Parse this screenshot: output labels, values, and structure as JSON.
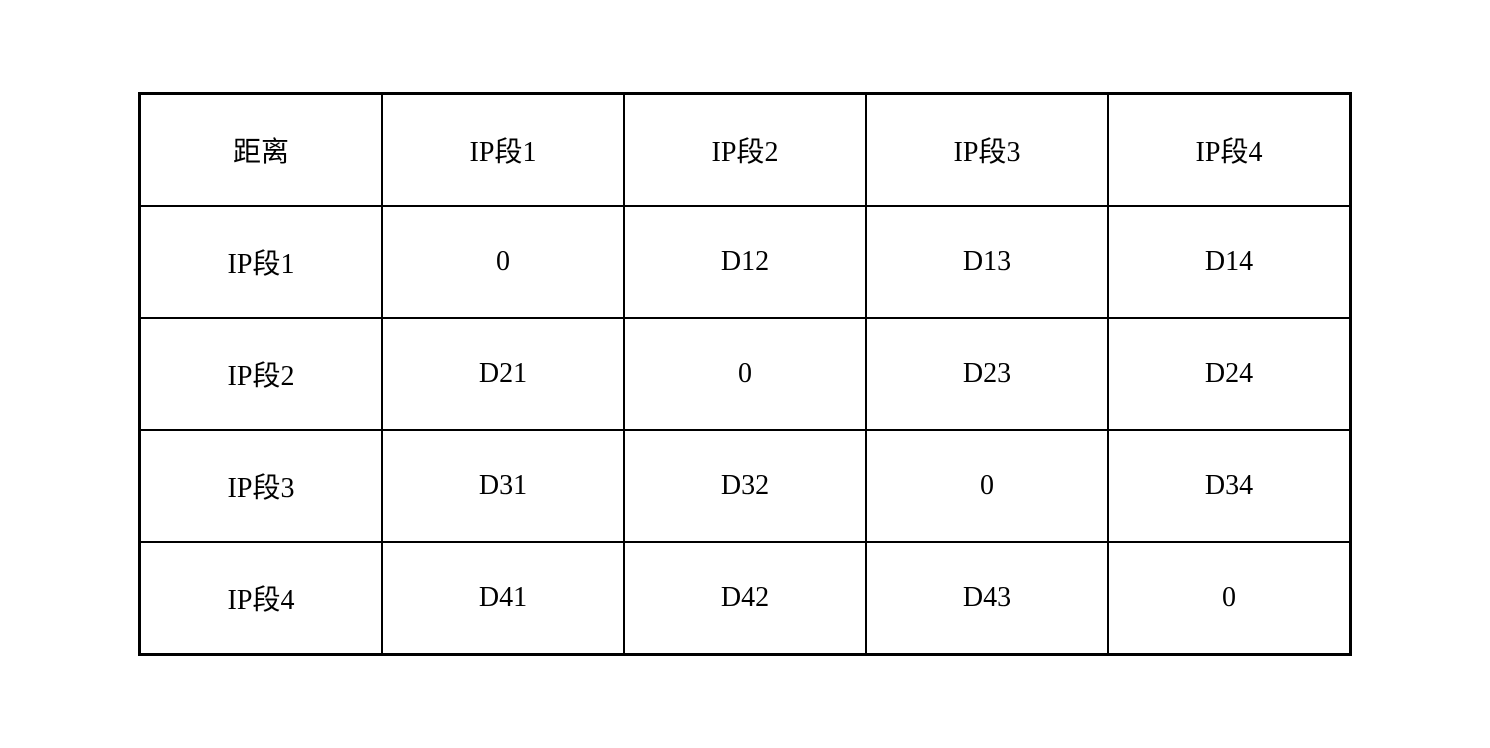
{
  "table": {
    "header": [
      "距离",
      "IP段1",
      "IP段2",
      "IP段3",
      "IP段4"
    ],
    "rows": [
      [
        "IP段1",
        "0",
        "D12",
        "D13",
        "D14"
      ],
      [
        "IP段2",
        "D21",
        "0",
        "D23",
        "D24"
      ],
      [
        "IP段3",
        "D31",
        "D32",
        "0",
        "D34"
      ],
      [
        "IP段4",
        "D41",
        "D42",
        "D43",
        "0"
      ]
    ]
  }
}
